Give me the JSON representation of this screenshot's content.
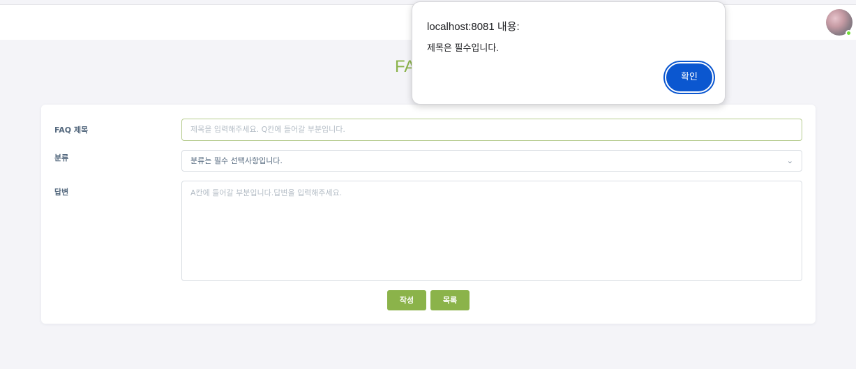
{
  "header": {
    "user_avatar_icon": "avatar-icon",
    "status_color": "#71dd37"
  },
  "page": {
    "title": "FA"
  },
  "form": {
    "title_label": "FAQ 제목",
    "title_placeholder": "제목을 입력해주세요. Q칸에 들어갈 부분입니다.",
    "category_label": "분류",
    "category_selected": "분류는 필수 선택사항입니다.",
    "answer_label": "답변",
    "answer_placeholder": "A칸에 들어갈 부분입니다.답변을 입력해주세요.",
    "write_button": "작성",
    "list_button": "목록",
    "accent_color": "#8bb34a"
  },
  "dialog": {
    "origin": "localhost:8081 내용:",
    "message": "제목은 필수입니다.",
    "ok_button": "확인",
    "button_color": "#0b57d0"
  }
}
